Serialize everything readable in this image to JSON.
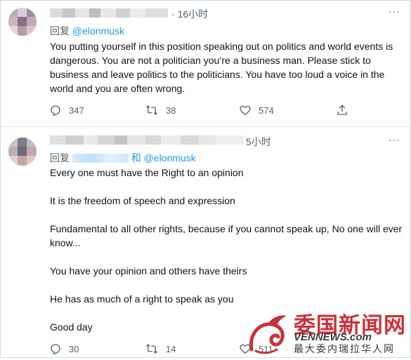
{
  "tweets": [
    {
      "time": "16小时",
      "reply_prefix": "回复",
      "reply_to": "@elonmusk",
      "text": "You putting yourself in this position speaking out on politics and world events is dangerous. You are not a politician you’re a business man. Please stick to business and leave politics to the politicians. You have too loud a voice in the world and you are often wrong.",
      "actions": {
        "replies": "347",
        "retweets": "38",
        "likes": "574"
      }
    },
    {
      "time": "5小时",
      "reply_prefix": "回复",
      "reply_and": "和",
      "reply_to": "@elonmusk",
      "paragraphs": [
        "Every one must have the Right to an opinion",
        "It is the freedom of speech and expression",
        "Fundamental to all other rights, because if you cannot speak up, No one will ever know...",
        "You have your opinion and others have theirs",
        "He has as much of a right to speak as you",
        "Good day"
      ],
      "actions": {
        "replies": "30",
        "retweets": "14",
        "likes": "511"
      }
    }
  ],
  "watermark": {
    "title": "委国新闻网",
    "url": "VENNEWS.com",
    "subtitle": "最大委内瑞拉华人网"
  },
  "icons": {
    "reply": "reply-icon",
    "retweet": "retweet-icon",
    "like": "heart-icon",
    "share": "share-icon",
    "more": "more-icon"
  },
  "colors": {
    "mention": "#1d9bf0",
    "muted": "#536471",
    "text": "#0f1419",
    "watermark": "#c9323b"
  }
}
